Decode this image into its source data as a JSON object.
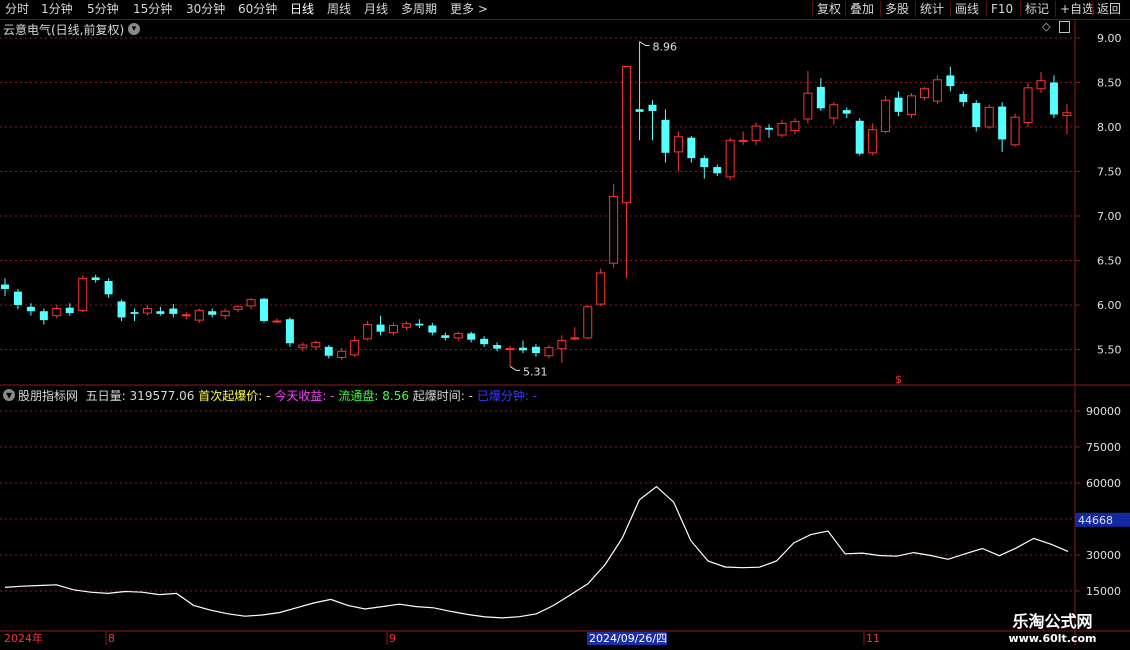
{
  "toolbar": {
    "periods": [
      "分时",
      "1分钟",
      "5分钟",
      "15分钟",
      "30分钟",
      "60分钟",
      "日线",
      "周线",
      "月线",
      "多周期",
      "更多 >"
    ],
    "active_period": "日线",
    "actions": [
      "复权",
      "叠加",
      "多股",
      "统计",
      "画线",
      "F10",
      "标记",
      "+自选",
      "返回"
    ]
  },
  "title": "云意电气(日线,前复权)",
  "price_axis": [
    "9.00",
    "8.50",
    "8.00",
    "7.50",
    "7.00",
    "6.50",
    "6.00",
    "5.50"
  ],
  "annotations": {
    "high": "8.96",
    "low": "5.31"
  },
  "dollar_mark": "$",
  "indicator": {
    "name": "股朋指标网",
    "wuriliang_label": "五日量:",
    "wuriliang_value": "319577.06",
    "shouci_label": "首次起爆价:",
    "shouci_value": "-",
    "jintian_label": "今天收益:",
    "jintian_value": "-",
    "liutong_label": "流通盘:",
    "liutong_value": "8.56",
    "qibao_time_label": "起爆时间:",
    "qibao_time_value": "-",
    "yibao_label": "已爆分钟:",
    "yibao_value": "-",
    "axis": [
      "90000",
      "75000",
      "60000",
      "45000",
      "30000",
      "15000"
    ],
    "current_value": "44668"
  },
  "date_axis": {
    "year": "2024年",
    "months": [
      "8",
      "9",
      "11"
    ],
    "highlight": "2024/09/26/四"
  },
  "watermark": {
    "line1": "乐淘公式网",
    "line2": "www.60lt.com"
  },
  "colors": {
    "up": "#ff3232",
    "down": "#54ffff",
    "grid": "#8b1a1a",
    "line": "#ffffff"
  },
  "chart_data": {
    "type": "candlestick",
    "ylim": [
      5.1,
      9.2
    ],
    "candles": [
      [
        6.23,
        6.18,
        6.3,
        6.1
      ],
      [
        6.15,
        6.0,
        6.18,
        5.95
      ],
      [
        5.98,
        5.93,
        6.02,
        5.88
      ],
      [
        5.93,
        5.83,
        5.96,
        5.78
      ],
      [
        5.88,
        5.96,
        6.0,
        5.85
      ],
      [
        5.97,
        5.91,
        6.02,
        5.88
      ],
      [
        5.94,
        6.3,
        6.33,
        5.92
      ],
      [
        6.31,
        6.28,
        6.34,
        6.25
      ],
      [
        6.27,
        6.12,
        6.3,
        6.08
      ],
      [
        6.04,
        5.86,
        6.06,
        5.82
      ],
      [
        5.92,
        5.9,
        5.96,
        5.82
      ],
      [
        5.91,
        5.96,
        6.0,
        5.88
      ],
      [
        5.93,
        5.9,
        5.98,
        5.88
      ],
      [
        5.96,
        5.9,
        6.01,
        5.86
      ],
      [
        5.89,
        5.89,
        5.92,
        5.84
      ],
      [
        5.83,
        5.94,
        5.96,
        5.8
      ],
      [
        5.93,
        5.89,
        5.96,
        5.86
      ],
      [
        5.88,
        5.93,
        5.96,
        5.84
      ],
      [
        5.95,
        5.98,
        6.0,
        5.92
      ],
      [
        5.99,
        6.06,
        6.08,
        5.95
      ],
      [
        6.07,
        5.82,
        6.08,
        5.8
      ],
      [
        5.82,
        5.82,
        5.85,
        5.8
      ],
      [
        5.84,
        5.57,
        5.86,
        5.53
      ],
      [
        5.52,
        5.55,
        5.58,
        5.48
      ],
      [
        5.53,
        5.58,
        5.6,
        5.5
      ],
      [
        5.53,
        5.43,
        5.55,
        5.4
      ],
      [
        5.41,
        5.48,
        5.52,
        5.38
      ],
      [
        5.44,
        5.6,
        5.65,
        5.42
      ],
      [
        5.62,
        5.78,
        5.82,
        5.6
      ],
      [
        5.78,
        5.7,
        5.88,
        5.66
      ],
      [
        5.69,
        5.77,
        5.8,
        5.66
      ],
      [
        5.75,
        5.79,
        5.82,
        5.72
      ],
      [
        5.79,
        5.77,
        5.84,
        5.74
      ],
      [
        5.77,
        5.69,
        5.8,
        5.66
      ],
      [
        5.66,
        5.63,
        5.69,
        5.6
      ],
      [
        5.63,
        5.68,
        5.7,
        5.6
      ],
      [
        5.68,
        5.61,
        5.7,
        5.58
      ],
      [
        5.62,
        5.56,
        5.65,
        5.53
      ],
      [
        5.55,
        5.51,
        5.58,
        5.48
      ],
      [
        5.51,
        5.51,
        5.54,
        5.31
      ],
      [
        5.52,
        5.49,
        5.6,
        5.46
      ],
      [
        5.53,
        5.46,
        5.56,
        5.42
      ],
      [
        5.43,
        5.52,
        5.55,
        5.4
      ],
      [
        5.51,
        5.6,
        5.66,
        5.35
      ],
      [
        5.62,
        5.63,
        5.75,
        5.6
      ],
      [
        5.63,
        5.98,
        6.0,
        5.62
      ],
      [
        6.01,
        6.36,
        6.41,
        5.99
      ],
      [
        6.47,
        7.22,
        7.36,
        6.42
      ],
      [
        7.15,
        8.68,
        8.68,
        6.3
      ],
      [
        8.2,
        8.17,
        8.96,
        7.85
      ],
      [
        8.25,
        8.18,
        8.3,
        7.85
      ],
      [
        8.08,
        7.71,
        8.2,
        7.6
      ],
      [
        7.72,
        7.89,
        7.95,
        7.5
      ],
      [
        7.88,
        7.65,
        7.9,
        7.6
      ],
      [
        7.65,
        7.55,
        7.68,
        7.42
      ],
      [
        7.55,
        7.48,
        7.58,
        7.45
      ],
      [
        7.44,
        7.85,
        7.88,
        7.4
      ],
      [
        7.85,
        7.85,
        7.95,
        7.8
      ],
      [
        7.85,
        8.01,
        8.05,
        7.8
      ],
      [
        7.99,
        7.97,
        8.03,
        7.88
      ],
      [
        7.91,
        8.04,
        8.08,
        7.88
      ],
      [
        7.96,
        8.06,
        8.1,
        7.92
      ],
      [
        8.09,
        8.38,
        8.63,
        8.04
      ],
      [
        8.45,
        8.21,
        8.55,
        8.18
      ],
      [
        8.1,
        8.25,
        8.28,
        8.03
      ],
      [
        8.19,
        8.15,
        8.22,
        8.1
      ],
      [
        8.07,
        7.7,
        8.1,
        7.68
      ],
      [
        7.71,
        7.97,
        8.04,
        7.68
      ],
      [
        7.95,
        8.3,
        8.35,
        7.93
      ],
      [
        8.33,
        8.17,
        8.4,
        8.12
      ],
      [
        8.14,
        8.35,
        8.38,
        8.1
      ],
      [
        8.33,
        8.43,
        8.45,
        8.3
      ],
      [
        8.29,
        8.53,
        8.58,
        8.26
      ],
      [
        8.58,
        8.46,
        8.68,
        8.4
      ],
      [
        8.37,
        8.28,
        8.4,
        8.23
      ],
      [
        8.27,
        8.0,
        8.3,
        7.95
      ],
      [
        8.0,
        8.22,
        8.25,
        7.98
      ],
      [
        8.23,
        7.86,
        8.28,
        7.72
      ],
      [
        7.8,
        8.11,
        8.15,
        7.78
      ],
      [
        8.05,
        8.44,
        8.5,
        8.0
      ],
      [
        8.43,
        8.52,
        8.62,
        8.38
      ],
      [
        8.5,
        8.14,
        8.58,
        8.1
      ],
      [
        8.13,
        8.16,
        8.26,
        7.92
      ]
    ],
    "volume_line": {
      "ylim": [
        10000,
        95000
      ],
      "values": [
        16500,
        17000,
        17300,
        17600,
        15500,
        14500,
        14000,
        14800,
        14500,
        13500,
        14000,
        9000,
        7000,
        5500,
        4500,
        5000,
        6000,
        8000,
        10000,
        11500,
        9000,
        7500,
        8500,
        9500,
        8500,
        8000,
        6500,
        5200,
        4200,
        3800,
        4300,
        5500,
        9000,
        13500,
        18000,
        26000,
        37000,
        53000,
        58500,
        52000,
        36000,
        27500,
        25000,
        24700,
        24900,
        27500,
        35000,
        38500,
        40000,
        30500,
        30800,
        29800,
        29500,
        31000,
        29800,
        28200,
        30500,
        32700,
        29700,
        33000,
        36900,
        34500,
        31500
      ]
    }
  }
}
